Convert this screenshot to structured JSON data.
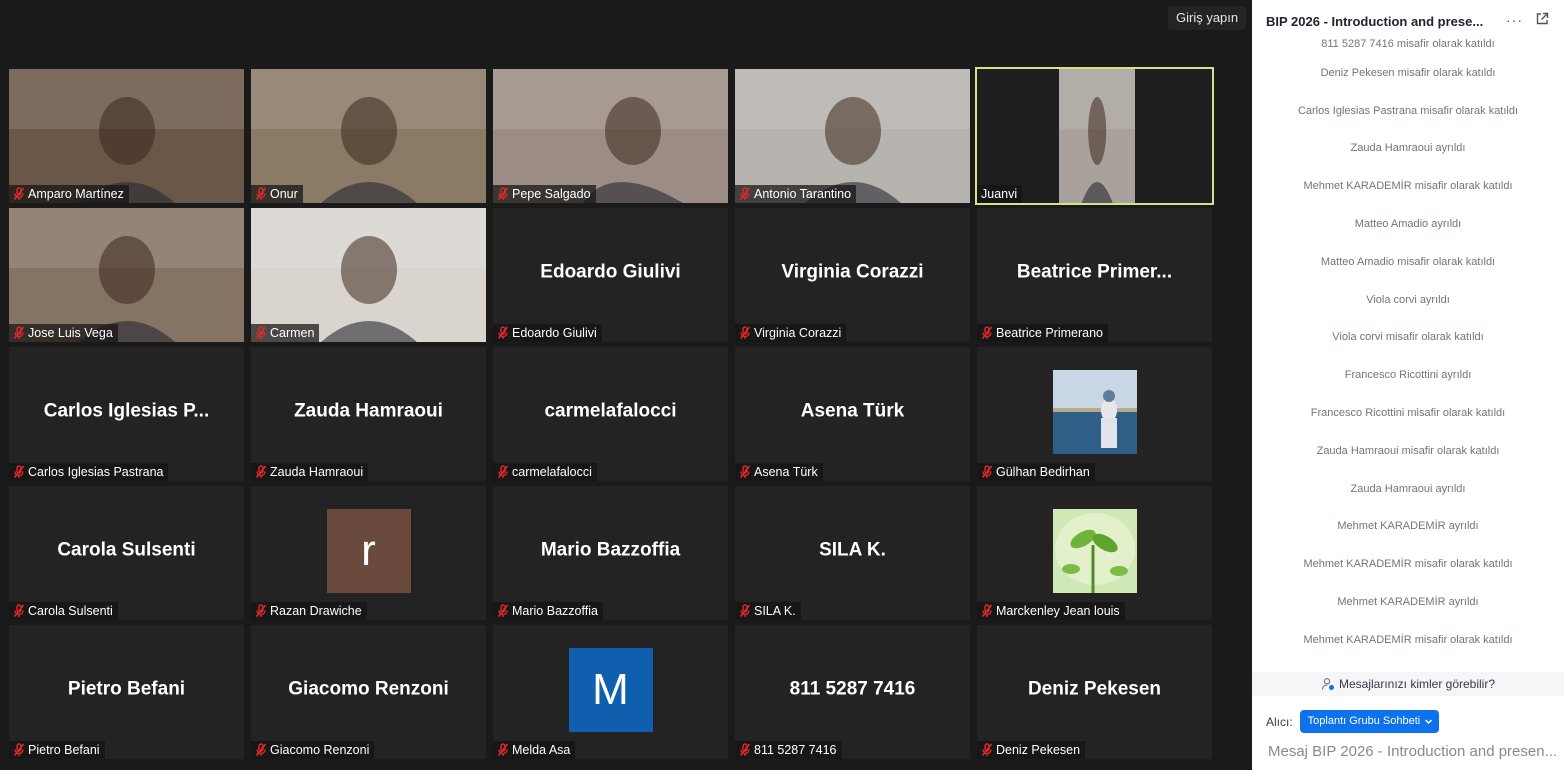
{
  "gallery": {
    "signin_label": "Giriş yapın",
    "tiles": [
      {
        "label": "Amparo Martínez",
        "type": "video",
        "muted": true,
        "bg": "#6b5747"
      },
      {
        "label": "Onur",
        "type": "video",
        "muted": true,
        "bg": "#8a7a66"
      },
      {
        "label": "Pepe Salgado",
        "type": "video",
        "muted": true,
        "bg": "#9b8c85"
      },
      {
        "label": "Antonio Tarantino",
        "type": "video",
        "muted": true,
        "bg": "#b7b3ae"
      },
      {
        "label": "Juanvi",
        "type": "video",
        "muted": false,
        "active": true,
        "bg": "#a9a29c"
      },
      {
        "label": "Jose Luis Vega",
        "type": "video",
        "muted": true,
        "bg": "#857364"
      },
      {
        "label": "Carmen",
        "type": "video",
        "muted": true,
        "bg": "#d9d4ce"
      },
      {
        "label": "Edoardo Giulivi",
        "name_display": "Edoardo Giulivi",
        "type": "name",
        "muted": true
      },
      {
        "label": "Virginia Corazzi",
        "name_display": "Virginia Corazzi",
        "type": "name",
        "muted": true
      },
      {
        "label": "Beatrice Primerano",
        "name_display": "Beatrice  Primer...",
        "type": "name",
        "muted": true
      },
      {
        "label": "Carlos Iglesias Pastrana",
        "name_display": "Carlos  Iglesias  P...",
        "type": "name",
        "muted": true
      },
      {
        "label": "Zauda Hamraoui",
        "name_display": "Zauda Hamraoui",
        "type": "name",
        "muted": true
      },
      {
        "label": "carmelafalocci",
        "name_display": "carmelafalocci",
        "type": "name",
        "muted": true
      },
      {
        "label": "Asena Türk",
        "name_display": "Asena Türk",
        "type": "name",
        "muted": true
      },
      {
        "label": "Gülhan Bedirhan",
        "type": "photo",
        "muted": true,
        "photo": "sea"
      },
      {
        "label": "Carola Sulsenti",
        "name_display": "Carola Sulsenti",
        "type": "name",
        "muted": true
      },
      {
        "label": "Razan Drawiche",
        "type": "letter",
        "letter": "r",
        "color": "#6b4a3e",
        "muted": true
      },
      {
        "label": "Mario Bazzoffia",
        "name_display": "Mario Bazzoffia",
        "type": "name",
        "muted": true
      },
      {
        "label": "SILA K.",
        "name_display": "SILA K.",
        "type": "name",
        "muted": true
      },
      {
        "label": "Marckenley Jean louis",
        "type": "photo",
        "muted": true,
        "photo": "plant"
      },
      {
        "label": "Pietro Befani",
        "name_display": "Pietro Befani",
        "type": "name",
        "muted": true
      },
      {
        "label": "Giacomo Renzoni",
        "name_display": "Giacomo Renzoni",
        "type": "name",
        "muted": true
      },
      {
        "label": "Melda Asa",
        "type": "letter",
        "letter": "M",
        "color": "#0f5fae",
        "muted": true
      },
      {
        "label": "811 5287 7416",
        "name_display": "811 5287 7416",
        "type": "name",
        "muted": true
      },
      {
        "label": "Deniz Pekesen",
        "name_display": "Deniz Pekesen",
        "type": "name",
        "muted": true
      }
    ]
  },
  "chat": {
    "title": "BIP 2026 - Introduction and prese...",
    "more_icon": "more-horizontal-icon",
    "popout_icon": "popout-icon",
    "messages": [
      "811 5287 7416 misafir olarak katıldı",
      "Deniz Pekesen misafir olarak katıldı",
      "Carlos Iglesias Pastrana misafir olarak katıldı",
      "Zauda Hamraoui ayrıldı",
      "Mehmet KARADEMİR misafir olarak katıldı",
      "Matteo Amadio  ayrıldı",
      "Matteo Amadio  misafir olarak katıldı",
      "Viola corvi ayrıldı",
      "Viola corvi misafir olarak katıldı",
      "Francesco Ricottini ayrıldı",
      "Francesco Ricottini misafir olarak katıldı",
      "Zauda Hamraoui misafir olarak katıldı",
      "Zauda Hamraoui ayrıldı",
      "Mehmet KARADEMİR ayrıldı",
      "Mehmet KARADEMİR misafir olarak katıldı",
      "Mehmet KARADEMİR ayrıldı",
      "Mehmet KARADEMİR misafir olarak katıldı"
    ],
    "privacy_text": "Mesajlarınızı kimler görebilir?",
    "to_label": "Alıcı:",
    "to_value": "Toplantı Grubu Sohbeti",
    "input_placeholder": "Mesaj BIP 2026 - Introduction and presen..."
  },
  "colors": {
    "active_speaker": "#d4e38a",
    "mute_red": "#e02828",
    "accent_blue": "#0e72ed"
  }
}
